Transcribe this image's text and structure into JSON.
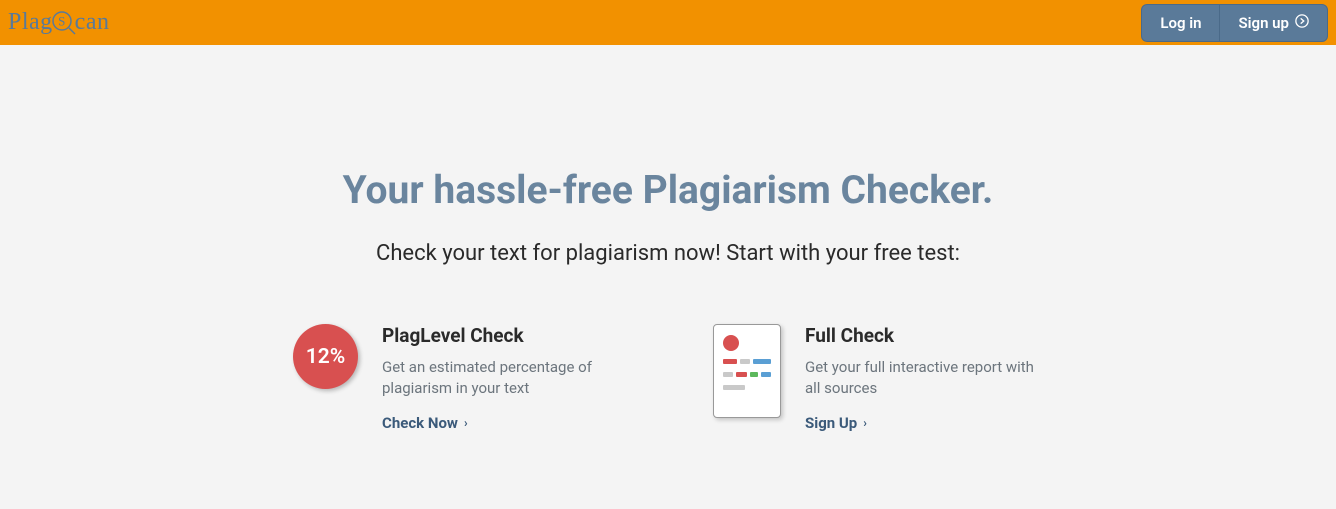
{
  "header": {
    "logo_plag": "Plag",
    "logo_s": "S",
    "logo_rest": "can",
    "login_label": "Log in",
    "signup_label": "Sign up"
  },
  "hero": {
    "title": "Your hassle-free Plagiarism Checker.",
    "subtitle": "Check your text for plagiarism now! Start with your free test:"
  },
  "options": {
    "plaglevel": {
      "badge_value": "12%",
      "title": "PlagLevel Check",
      "description": "Get an estimated percentage of plagiarism in your text",
      "cta": "Check Now"
    },
    "fullcheck": {
      "title": "Full Check",
      "description": "Get your full interactive report with all sources",
      "cta": "Sign Up"
    }
  }
}
